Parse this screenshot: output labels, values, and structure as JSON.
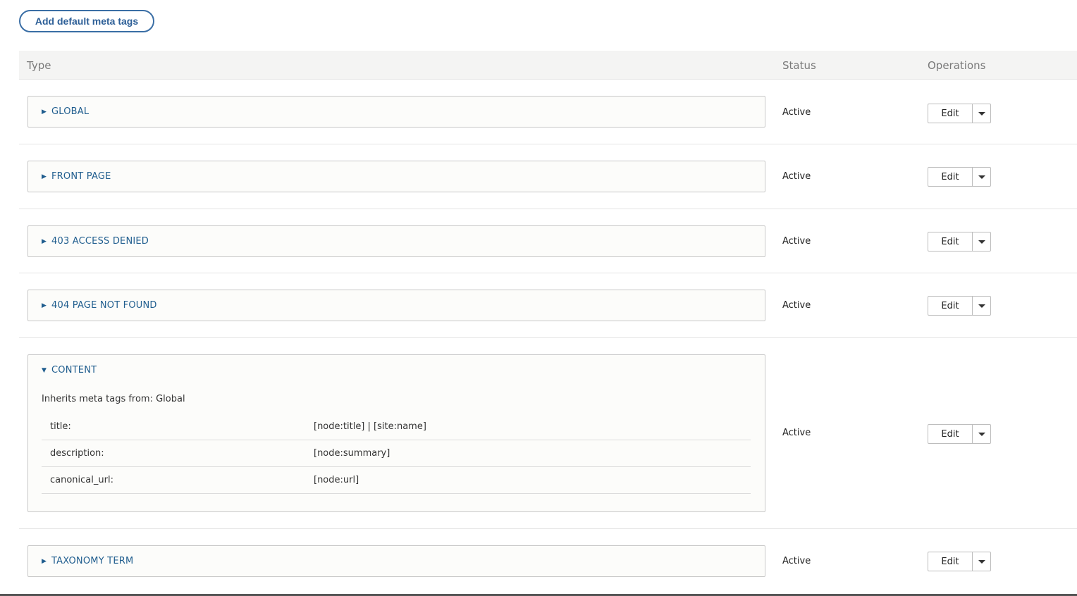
{
  "add_button": {
    "label": "Add default meta tags"
  },
  "table": {
    "headers": {
      "type": "Type",
      "status": "Status",
      "operations": "Operations"
    },
    "rows": [
      {
        "label": "GLOBAL",
        "status": "Active",
        "edit": "Edit",
        "expanded": false
      },
      {
        "label": "FRONT PAGE",
        "status": "Active",
        "edit": "Edit",
        "expanded": false
      },
      {
        "label": "403 ACCESS DENIED",
        "status": "Active",
        "edit": "Edit",
        "expanded": false
      },
      {
        "label": "404 PAGE NOT FOUND",
        "status": "Active",
        "edit": "Edit",
        "expanded": false
      },
      {
        "label": "CONTENT",
        "status": "Active",
        "edit": "Edit",
        "expanded": true,
        "inherits": "Inherits meta tags from: Global",
        "tags": [
          {
            "key": "title:",
            "value": "[node:title] | [site:name]"
          },
          {
            "key": "description:",
            "value": "[node:summary]"
          },
          {
            "key": "canonical_url:",
            "value": "[node:url]"
          }
        ]
      },
      {
        "label": "TAXONOMY TERM",
        "status": "Active",
        "edit": "Edit",
        "expanded": false
      }
    ]
  },
  "icons": {
    "collapsed": "triangle-right-icon",
    "expanded": "triangle-down-icon",
    "dropdown": "caret-down-icon"
  }
}
